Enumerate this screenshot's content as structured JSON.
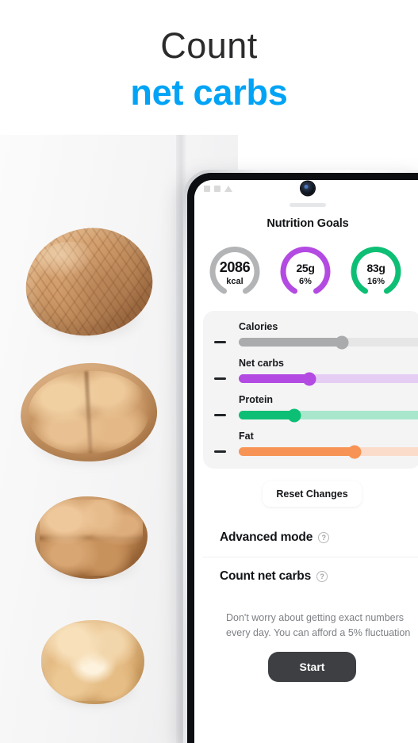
{
  "headline": {
    "line1": "Count",
    "line2": "net carbs",
    "accent_color": "#00a3f5"
  },
  "phone": {
    "status_bar": {
      "icons": [
        "signal-icon",
        "wifi-icon",
        "battery-icon"
      ]
    },
    "camera": "front-camera"
  },
  "sheet": {
    "title": "Nutrition Goals",
    "gauges": [
      {
        "name": "calories",
        "value": "2086",
        "unit": "kcal",
        "color": "#b3b4b6",
        "percent_sweep": 88
      },
      {
        "name": "net-carbs",
        "value": "25",
        "unit_suffix": "g",
        "sub": "6%",
        "color": "#b34ae2",
        "percent_sweep": 88
      },
      {
        "name": "protein",
        "value": "83",
        "unit_suffix": "g",
        "sub": "16%",
        "color": "#0dbf74",
        "percent_sweep": 88
      },
      {
        "name": "fat",
        "value": "",
        "sub": "",
        "color": "#f79455",
        "percent_sweep": 88
      }
    ],
    "sliders": [
      {
        "label": "Calories",
        "fill": "#aaabad",
        "rail": "#e6e6e7",
        "thumb": "#aaabad",
        "pos": 48
      },
      {
        "label": "Net carbs",
        "fill": "#b34ae2",
        "rail": "#e5cdf4",
        "thumb": "#b34ae2",
        "pos": 33
      },
      {
        "label": "Protein",
        "fill": "#0dbf74",
        "rail": "#a9e7cd",
        "thumb": "#0dbf74",
        "pos": 26
      },
      {
        "label": "Fat",
        "fill": "#f79455",
        "rail": "#fbdccb",
        "thumb": "#f79455",
        "pos": 54
      }
    ],
    "reset_label": "Reset Changes",
    "options": [
      {
        "label": "Advanced mode",
        "help": "?"
      },
      {
        "label": "Count net carbs",
        "help": "?"
      }
    ],
    "note": "Don't worry about getting exact numbers every day. You can afford a 5% fluctuation",
    "start_label": "Start"
  },
  "photo": {
    "items": [
      "walnut-whole",
      "walnut-half-in-shell",
      "walnut-kernel-dark",
      "walnut-kernel-light"
    ]
  }
}
